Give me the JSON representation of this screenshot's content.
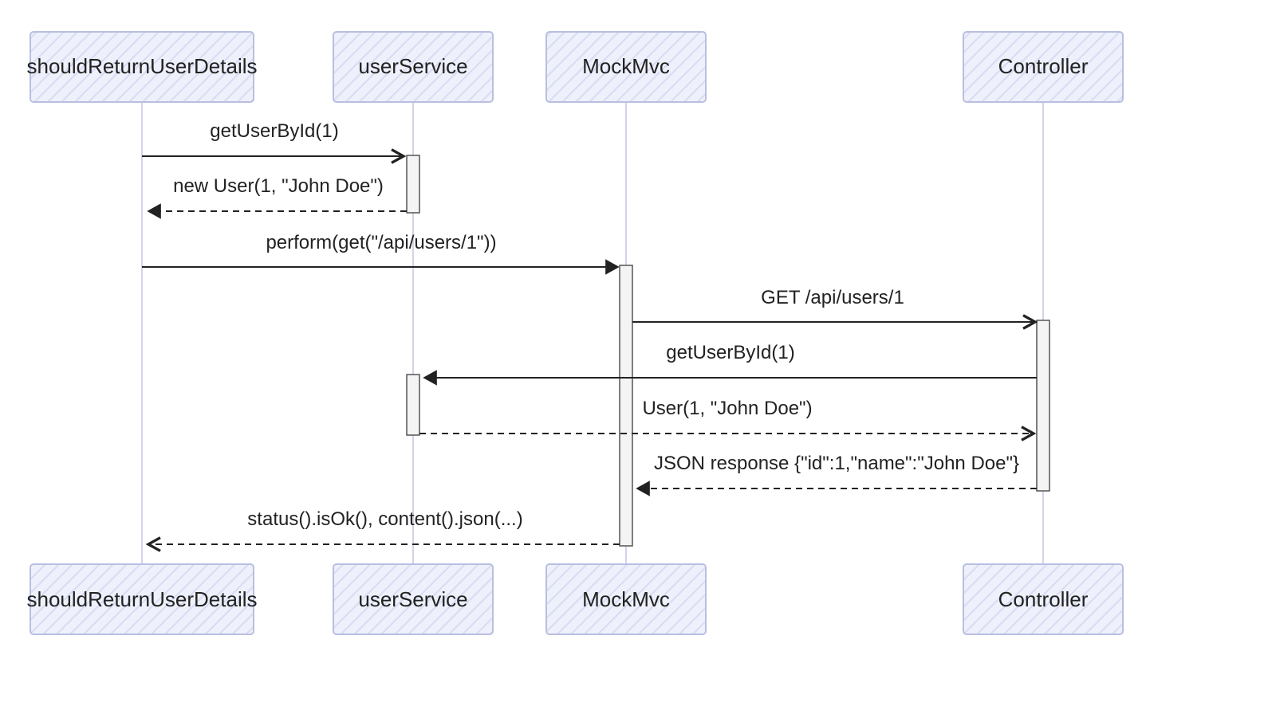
{
  "participants": {
    "p0": "shouldReturnUserDetails",
    "p1": "userService",
    "p2": "MockMvc",
    "p3": "Controller"
  },
  "messages": {
    "m0": "getUserById(1)",
    "m1": "new User(1, \"John Doe\")",
    "m2": "perform(get(\"/api/users/1\"))",
    "m3": "GET /api/users/1",
    "m4": "getUserById(1)",
    "m5": "User(1, \"John Doe\")",
    "m6": "JSON response {\"id\":1,\"name\":\"John Doe\"}",
    "m7": "status().isOk(), content().json(...)"
  },
  "chart_data": {
    "type": "sequence-diagram",
    "participants": [
      "shouldReturnUserDetails",
      "userService",
      "MockMvc",
      "Controller"
    ],
    "interactions": [
      {
        "from": "shouldReturnUserDetails",
        "to": "userService",
        "label": "getUserById(1)",
        "style": "sync"
      },
      {
        "from": "userService",
        "to": "shouldReturnUserDetails",
        "label": "new User(1, \"John Doe\")",
        "style": "return"
      },
      {
        "from": "shouldReturnUserDetails",
        "to": "MockMvc",
        "label": "perform(get(\"/api/users/1\"))",
        "style": "sync"
      },
      {
        "from": "MockMvc",
        "to": "Controller",
        "label": "GET /api/users/1",
        "style": "sync"
      },
      {
        "from": "Controller",
        "to": "userService",
        "label": "getUserById(1)",
        "style": "sync"
      },
      {
        "from": "userService",
        "to": "Controller",
        "label": "User(1, \"John Doe\")",
        "style": "return"
      },
      {
        "from": "Controller",
        "to": "MockMvc",
        "label": "JSON response {\"id\":1,\"name\":\"John Doe\"}",
        "style": "return"
      },
      {
        "from": "MockMvc",
        "to": "shouldReturnUserDetails",
        "label": "status().isOk(), content().json(...)",
        "style": "return"
      }
    ]
  }
}
